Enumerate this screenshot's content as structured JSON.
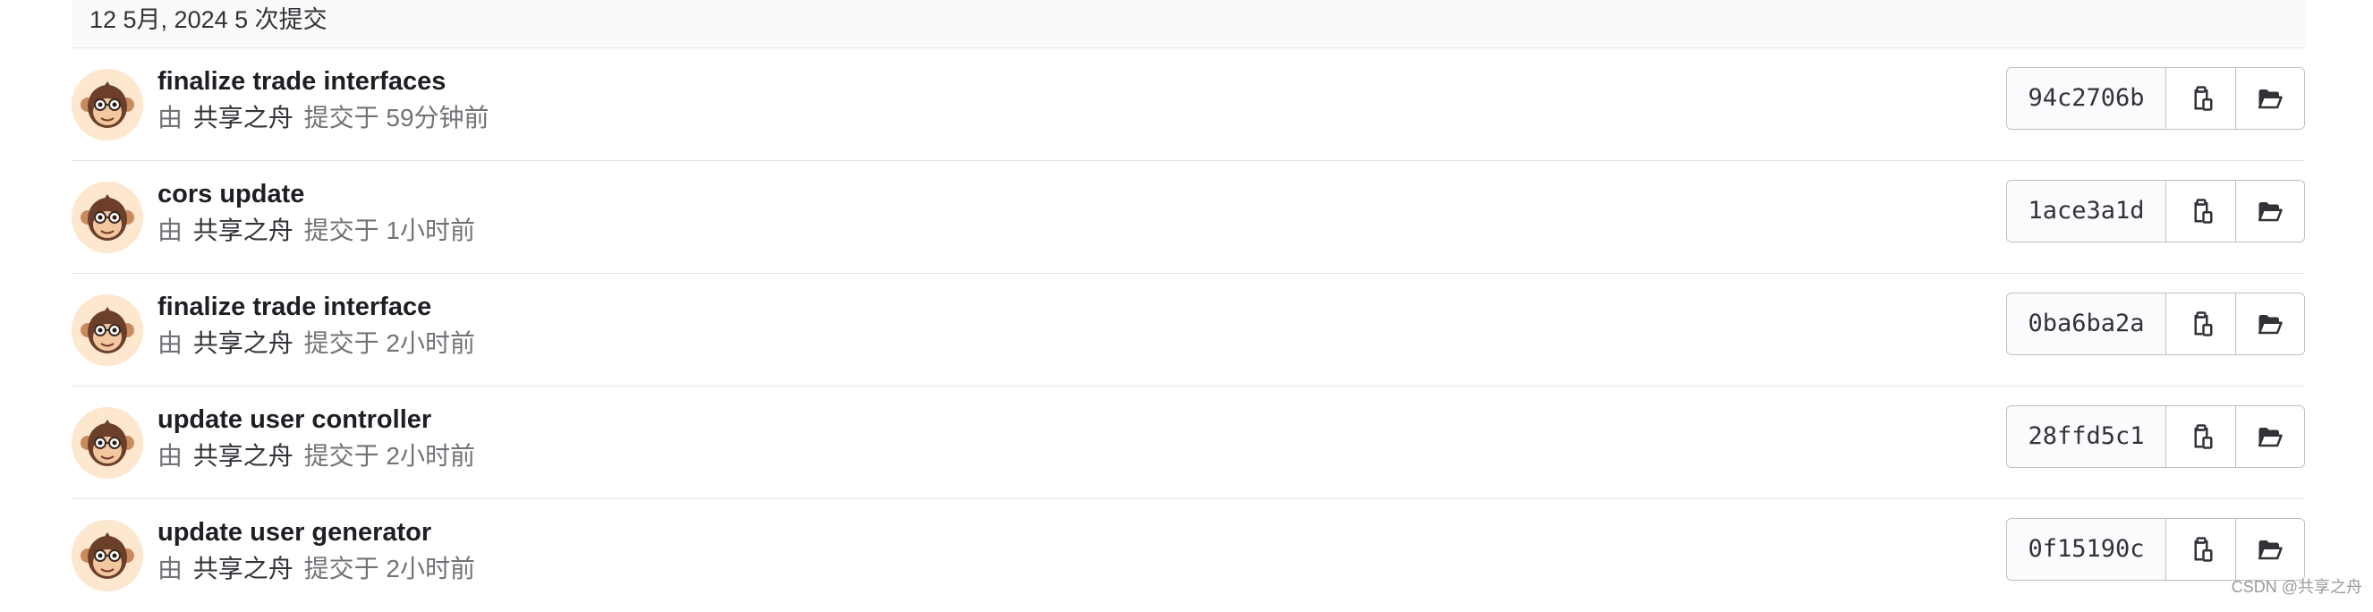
{
  "day_header": {
    "text": "12 5月, 2024 5 次提交"
  },
  "commits": [
    {
      "title": "finalize trade interfaces",
      "by": "由",
      "author": "共享之舟",
      "time": "提交于 59分钟前",
      "sha": "94c2706b"
    },
    {
      "title": "cors update",
      "by": "由",
      "author": "共享之舟",
      "time": "提交于 1小时前",
      "sha": "1ace3a1d"
    },
    {
      "title": "finalize trade interface",
      "by": "由",
      "author": "共享之舟",
      "time": "提交于 2小时前",
      "sha": "0ba6ba2a"
    },
    {
      "title": "update user controller",
      "by": "由",
      "author": "共享之舟",
      "time": "提交于 2小时前",
      "sha": "28ffd5c1"
    },
    {
      "title": "update user generator",
      "by": "由",
      "author": "共享之舟",
      "time": "提交于 2小时前",
      "sha": "0f15190c"
    }
  ],
  "icons": {
    "avatar": "monkey-avatar-icon",
    "copy": "copy-to-clipboard-icon",
    "browse": "folder-open-icon"
  },
  "colors": {
    "header_bg": "#fafafa",
    "border": "#e4e4e7",
    "muted_text": "#737278",
    "avatar_bg": "#fde7cf"
  },
  "watermark": "CSDN @共享之舟"
}
